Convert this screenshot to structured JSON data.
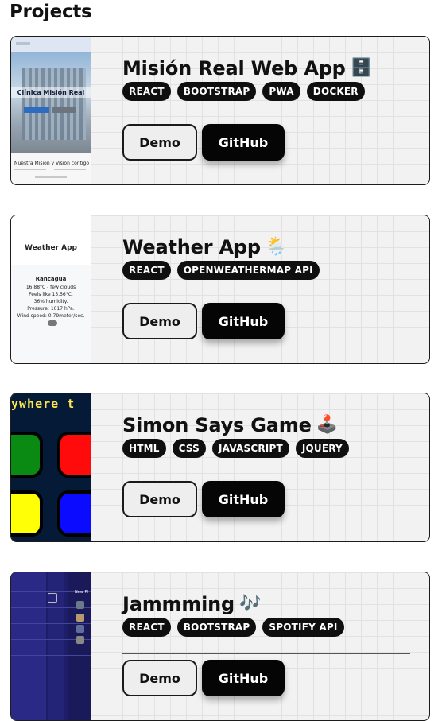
{
  "section": {
    "heading": "Projects"
  },
  "projects": [
    {
      "title": "Misión Real Web App",
      "emoji": "🗄️",
      "tags": [
        "REACT",
        "BOOTSTRAP",
        "PWA",
        "DOCKER"
      ],
      "demo_label": "Demo",
      "github_label": "GitHub",
      "thumbnail": {
        "hero_text": "Clínica Misión Real",
        "footer_text": "Nuestra Misión y Visión contigo"
      }
    },
    {
      "title": "Weather App",
      "emoji": "🌦️",
      "tags": [
        "REACT",
        "OPENWEATHERMAP API"
      ],
      "demo_label": "Demo",
      "github_label": "GitHub",
      "thumbnail": {
        "app_title": "Weather App",
        "city": "Rancagua",
        "lines": [
          "16.88°C - few clouds",
          "Feels like 15.56°C.",
          "36% humidity.",
          "Pressure: 1017 hPa.",
          "Wind speed: 0.79meter/sec."
        ]
      }
    },
    {
      "title": "Simon Says Game",
      "emoji": "🕹️",
      "tags": [
        "HTML",
        "CSS",
        "JAVASCRIPT",
        "JQUERY"
      ],
      "demo_label": "Demo",
      "github_label": "GitHub",
      "thumbnail": {
        "marquee_text": "ywhere t"
      }
    },
    {
      "title": "Jammming",
      "emoji": "🎶",
      "tags": [
        "REACT",
        "BOOTSTRAP",
        "SPOTIFY API"
      ],
      "demo_label": "Demo",
      "github_label": "GitHub",
      "thumbnail": {
        "panel_label": "New Pl"
      }
    }
  ]
}
